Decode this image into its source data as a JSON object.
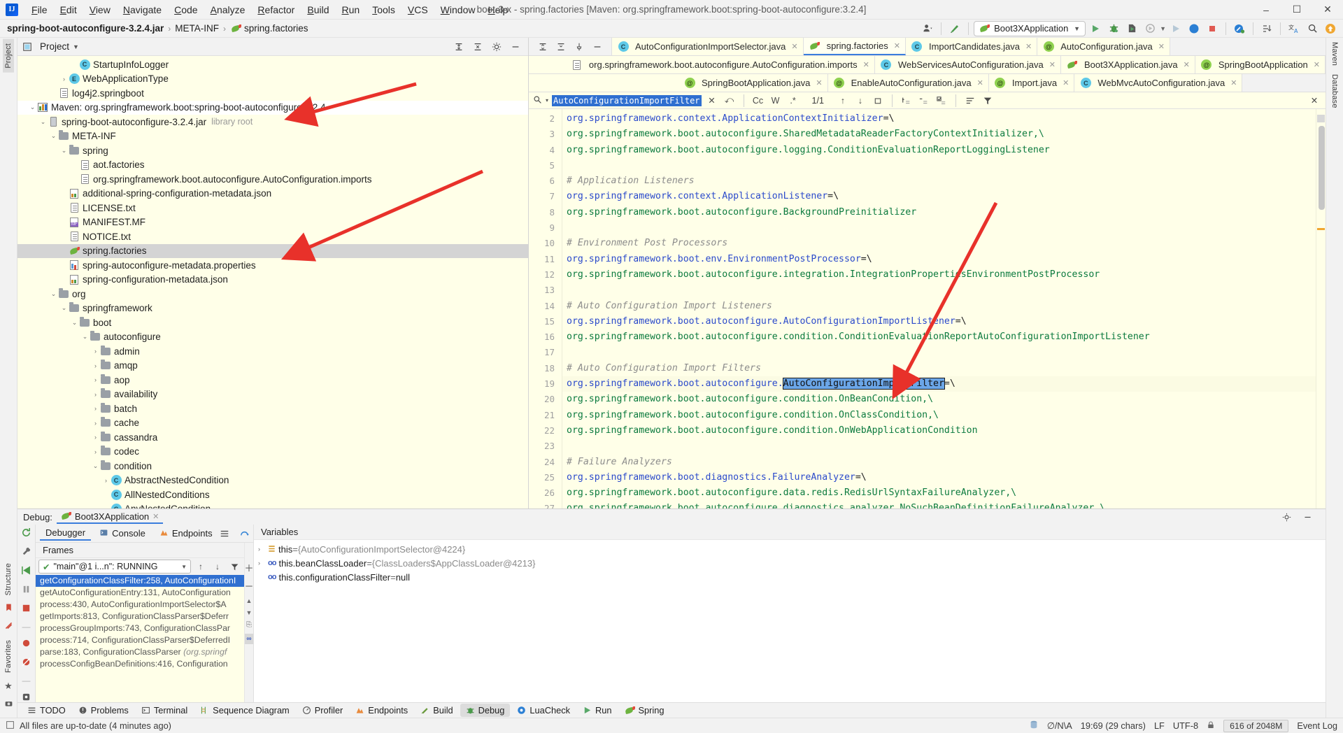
{
  "window": {
    "title": "boot-3-x - spring.factories [Maven: org.springframework.boot:spring-boot-autoconfigure:3.2.4]",
    "minimize": "–",
    "maximize": "☐",
    "close": "✕"
  },
  "menu": [
    "File",
    "Edit",
    "View",
    "Navigate",
    "Code",
    "Analyze",
    "Refactor",
    "Build",
    "Run",
    "Tools",
    "VCS",
    "Window",
    "Help"
  ],
  "navbar": {
    "crumbs": [
      "spring-boot-autoconfigure-3.2.4.jar",
      "META-INF",
      "spring.factories"
    ],
    "separator": "›",
    "run_config": "Boot3XApplication",
    "icons": {
      "account": "account-icon",
      "updates": "update-icon",
      "run": "run-icon",
      "debug": "debug-icon",
      "run_with_coverage": "coverage-icon",
      "profiler": "profiler-icon",
      "stop": "stop-icon",
      "search": "search-icon",
      "translate": "translate-icon",
      "notifications": "notification-icon"
    }
  },
  "left_rail": {
    "tabs": [
      "Project",
      "Structure",
      "Favorites"
    ]
  },
  "right_rail": {
    "tabs": [
      "Maven",
      "Database"
    ]
  },
  "project": {
    "title": "Project",
    "tree": [
      {
        "indent": 5,
        "chev": "",
        "icon": "class",
        "label": "StartupInfoLogger"
      },
      {
        "indent": 4,
        "chev": "›",
        "icon": "enum",
        "label": "WebApplicationType"
      },
      {
        "indent": 3,
        "chev": "",
        "icon": "file",
        "label": "log4j2.springboot"
      },
      {
        "indent": 1,
        "chev": "⌄",
        "icon": "maven",
        "label": "Maven: org.springframework.boot:spring-boot-autoconfigure:3.2.4",
        "state": "focused"
      },
      {
        "indent": 2,
        "chev": "⌄",
        "icon": "jar",
        "label": "spring-boot-autoconfigure-3.2.4.jar",
        "dim": "library root"
      },
      {
        "indent": 3,
        "chev": "⌄",
        "icon": "folder",
        "label": "META-INF"
      },
      {
        "indent": 4,
        "chev": "⌄",
        "icon": "folder",
        "label": "spring"
      },
      {
        "indent": 5,
        "chev": "",
        "icon": "file",
        "label": "aot.factories"
      },
      {
        "indent": 5,
        "chev": "",
        "icon": "file",
        "label": "org.springframework.boot.autoconfigure.AutoConfiguration.imports"
      },
      {
        "indent": 4,
        "chev": "",
        "icon": "json",
        "label": "additional-spring-configuration-metadata.json"
      },
      {
        "indent": 4,
        "chev": "",
        "icon": "file",
        "label": "LICENSE.txt"
      },
      {
        "indent": 4,
        "chev": "",
        "icon": "mf",
        "label": "MANIFEST.MF"
      },
      {
        "indent": 4,
        "chev": "",
        "icon": "file",
        "label": "NOTICE.txt"
      },
      {
        "indent": 4,
        "chev": "",
        "icon": "spring",
        "label": "spring.factories",
        "state": "selected"
      },
      {
        "indent": 4,
        "chev": "",
        "icon": "props",
        "label": "spring-autoconfigure-metadata.properties"
      },
      {
        "indent": 4,
        "chev": "",
        "icon": "json",
        "label": "spring-configuration-metadata.json"
      },
      {
        "indent": 3,
        "chev": "⌄",
        "icon": "folder",
        "label": "org"
      },
      {
        "indent": 4,
        "chev": "⌄",
        "icon": "folder",
        "label": "springframework"
      },
      {
        "indent": 5,
        "chev": "⌄",
        "icon": "folder",
        "label": "boot"
      },
      {
        "indent": 6,
        "chev": "⌄",
        "icon": "folder",
        "label": "autoconfigure"
      },
      {
        "indent": 7,
        "chev": "›",
        "icon": "folder",
        "label": "admin"
      },
      {
        "indent": 7,
        "chev": "›",
        "icon": "folder",
        "label": "amqp"
      },
      {
        "indent": 7,
        "chev": "›",
        "icon": "folder",
        "label": "aop"
      },
      {
        "indent": 7,
        "chev": "›",
        "icon": "folder",
        "label": "availability"
      },
      {
        "indent": 7,
        "chev": "›",
        "icon": "folder",
        "label": "batch"
      },
      {
        "indent": 7,
        "chev": "›",
        "icon": "folder",
        "label": "cache"
      },
      {
        "indent": 7,
        "chev": "›",
        "icon": "folder",
        "label": "cassandra"
      },
      {
        "indent": 7,
        "chev": "›",
        "icon": "folder",
        "label": "codec"
      },
      {
        "indent": 7,
        "chev": "⌄",
        "icon": "folder",
        "label": "condition"
      },
      {
        "indent": 8,
        "chev": "›",
        "icon": "class",
        "label": "AbstractNestedCondition"
      },
      {
        "indent": 8,
        "chev": "",
        "icon": "class",
        "label": "AllNestedConditions"
      },
      {
        "indent": 8,
        "chev": "",
        "icon": "class",
        "label": "AnyNestedCondition"
      }
    ]
  },
  "editor": {
    "tab_rows": [
      [
        {
          "icon": "class",
          "label": "AutoConfigurationImportSelector.java",
          "active": false
        },
        {
          "icon": "spring",
          "label": "spring.factories",
          "active": true
        },
        {
          "icon": "class",
          "label": "ImportCandidates.java",
          "active": false
        },
        {
          "icon": "annotation",
          "label": "AutoConfiguration.java",
          "active": false
        }
      ],
      [
        {
          "icon": "file",
          "label": "org.springframework.boot.autoconfigure.AutoConfiguration.imports",
          "active": false
        },
        {
          "icon": "class",
          "label": "WebServicesAutoConfiguration.java",
          "active": false
        },
        {
          "icon": "springapp",
          "label": "Boot3XApplication.java",
          "active": false
        },
        {
          "icon": "annotation",
          "label": "SpringBootApplication",
          "active": false
        }
      ],
      [
        {
          "icon": "annotation",
          "label": "SpringBootApplication.java",
          "active": false
        },
        {
          "icon": "annotation",
          "label": "EnableAutoConfiguration.java",
          "active": false
        },
        {
          "icon": "annotation",
          "label": "Import.java",
          "active": false
        },
        {
          "icon": "class",
          "label": "WebMvcAutoConfiguration.java",
          "active": false
        }
      ]
    ],
    "find": {
      "query": "AutoConfigurationImportFilter",
      "match_count": "1/1",
      "options": [
        "Cc",
        "W",
        ".*"
      ],
      "icons": [
        "search-icon",
        "clear-icon",
        "history-icon",
        "prev-match-icon",
        "next-match-icon",
        "select-all-icon",
        "add-line-icon",
        "remove-line-icon",
        "toggle-line-icon",
        "filter-list-icon",
        "filter-icon",
        "close-icon"
      ]
    },
    "line_start": 2,
    "lines": [
      {
        "n": 2,
        "segs": [
          {
            "t": "org.springframework.context.ApplicationContextInitializer",
            "c": "blue"
          },
          {
            "t": "=\\",
            "c": "punct"
          }
        ]
      },
      {
        "n": 3,
        "segs": [
          {
            "t": "org.springframework.boot.autoconfigure.SharedMetadataReaderFactoryContextInitializer,\\",
            "c": "green"
          }
        ]
      },
      {
        "n": 4,
        "segs": [
          {
            "t": "org.springframework.boot.autoconfigure.logging.ConditionEvaluationReportLoggingListener",
            "c": "green"
          }
        ]
      },
      {
        "n": 5,
        "segs": []
      },
      {
        "n": 6,
        "segs": [
          {
            "t": "# Application Listeners",
            "c": "comment"
          }
        ]
      },
      {
        "n": 7,
        "segs": [
          {
            "t": "org.springframework.context.ApplicationListener",
            "c": "blue"
          },
          {
            "t": "=\\",
            "c": "punct"
          }
        ]
      },
      {
        "n": 8,
        "segs": [
          {
            "t": "org.springframework.boot.autoconfigure.BackgroundPreinitializer",
            "c": "green"
          }
        ]
      },
      {
        "n": 9,
        "segs": []
      },
      {
        "n": 10,
        "segs": [
          {
            "t": "# Environment Post Processors",
            "c": "comment"
          }
        ]
      },
      {
        "n": 11,
        "segs": [
          {
            "t": "org.springframework.boot.env.EnvironmentPostProcessor",
            "c": "blue"
          },
          {
            "t": "=\\",
            "c": "punct"
          }
        ]
      },
      {
        "n": 12,
        "segs": [
          {
            "t": "org.springframework.boot.autoconfigure.integration.IntegrationPropertiesEnvironmentPostProcessor",
            "c": "green"
          }
        ]
      },
      {
        "n": 13,
        "segs": []
      },
      {
        "n": 14,
        "segs": [
          {
            "t": "# Auto Configuration Import Listeners",
            "c": "comment"
          }
        ]
      },
      {
        "n": 15,
        "segs": [
          {
            "t": "org.springframework.boot.autoconfigure.AutoConfigurationImportListener",
            "c": "blue"
          },
          {
            "t": "=\\",
            "c": "punct"
          }
        ]
      },
      {
        "n": 16,
        "segs": [
          {
            "t": "org.springframework.boot.autoconfigure.condition.ConditionEvaluationReportAutoConfigurationImportListener",
            "c": "green"
          }
        ]
      },
      {
        "n": 17,
        "segs": []
      },
      {
        "n": 18,
        "segs": [
          {
            "t": "# Auto Configuration Import Filters",
            "c": "comment"
          }
        ]
      },
      {
        "n": 19,
        "highlight": true,
        "segs": [
          {
            "t": "org.springframework.boot.autoconfigure.",
            "c": "blue"
          },
          {
            "t": "AutoConfigurationImportFilter",
            "c": "selword"
          },
          {
            "t": "=\\",
            "c": "punct"
          }
        ]
      },
      {
        "n": 20,
        "segs": [
          {
            "t": "org.springframework.boot.autoconfigure.condition.OnBeanCondition,\\",
            "c": "green"
          }
        ]
      },
      {
        "n": 21,
        "segs": [
          {
            "t": "org.springframework.boot.autoconfigure.condition.OnClassCondition,\\",
            "c": "green"
          }
        ]
      },
      {
        "n": 22,
        "segs": [
          {
            "t": "org.springframework.boot.autoconfigure.condition.OnWebApplicationCondition",
            "c": "green"
          }
        ]
      },
      {
        "n": 23,
        "segs": []
      },
      {
        "n": 24,
        "segs": [
          {
            "t": "# Failure Analyzers",
            "c": "comment"
          }
        ]
      },
      {
        "n": 25,
        "segs": [
          {
            "t": "org.springframework.boot.diagnostics.FailureAnalyzer",
            "c": "blue"
          },
          {
            "t": "=\\",
            "c": "punct"
          }
        ]
      },
      {
        "n": 26,
        "segs": [
          {
            "t": "org.springframework.boot.autoconfigure.data.redis.RedisUrlSyntaxFailureAnalyzer,\\",
            "c": "green"
          }
        ]
      },
      {
        "n": 27,
        "segs": [
          {
            "t": "org.springframework.boot.autoconfigure.diagnostics.analyzer.NoSuchBeanDefinitionFailureAnalyzer,\\",
            "c": "green"
          }
        ]
      }
    ]
  },
  "debug": {
    "label": "Debug:",
    "session": "Boot3XApplication",
    "tabs": [
      {
        "label": "Debugger",
        "icon": "debugger-icon",
        "active": true
      },
      {
        "label": "Console",
        "icon": "console-icon",
        "active": false
      },
      {
        "label": "Endpoints",
        "icon": "endpoints-icon",
        "active": false
      }
    ],
    "toolbar_icons": [
      "rerun-icon",
      "settings-icon",
      "resume-icon",
      "pause-icon",
      "stop-icon",
      "mute-breakpoints-icon",
      "view-breakpoints-icon",
      "layout-icon",
      "step-over-icon",
      "step-into-icon",
      "force-step-into-icon",
      "step-out-icon",
      "drop-frame-icon",
      "run-to-cursor-icon",
      "evaluate-icon",
      "settings2-icon"
    ],
    "frames_header": "Frames",
    "variables_header": "Variables",
    "thread": "\"main\"@1 i...n\": RUNNING",
    "frames": [
      {
        "text": "getConfigurationClassFilter:258, AutoConfigurationI",
        "selected": true
      },
      {
        "text": "getAutoConfigurationEntry:131, AutoConfiguration",
        "selected": false
      },
      {
        "text": "process:430, AutoConfigurationImportSelector$A",
        "selected": false
      },
      {
        "text": "getImports:813, ConfigurationClassParser$Deferr",
        "selected": false
      },
      {
        "text": "processGroupImports:743, ConfigurationClassPar",
        "selected": false
      },
      {
        "text": "process:714, ConfigurationClassParser$DeferredI",
        "selected": false
      },
      {
        "text": "parse:183, ConfigurationClassParser ",
        "italic": "(org.springf",
        "selected": false
      },
      {
        "text": "processConfigBeanDefinitions:416, Configuration",
        "selected": false
      }
    ],
    "variables": [
      {
        "chev": "›",
        "icon": "object-icon",
        "name": "this",
        "eq": " = ",
        "value": "{AutoConfigurationImportSelector@4224}"
      },
      {
        "chev": "›",
        "icon": "field-icon",
        "name": "this.beanClassLoader",
        "eq": " = ",
        "value": "{ClassLoaders$AppClassLoader@4213}"
      },
      {
        "chev": "",
        "icon": "field-icon",
        "name": "this.configurationClassFilter",
        "eq": " = ",
        "value": "null",
        "null": true
      }
    ]
  },
  "tool_windows": [
    {
      "label": "TODO",
      "icon": "todo-icon",
      "active": false
    },
    {
      "label": "Problems",
      "icon": "problems-icon",
      "active": false
    },
    {
      "label": "Terminal",
      "icon": "terminal-icon",
      "active": false
    },
    {
      "label": "Sequence Diagram",
      "icon": "sequence-diagram-icon",
      "active": false
    },
    {
      "label": "Profiler",
      "icon": "profiler-icon",
      "active": false
    },
    {
      "label": "Endpoints",
      "icon": "endpoints-icon",
      "active": false
    },
    {
      "label": "Build",
      "icon": "build-icon",
      "active": false
    },
    {
      "label": "Debug",
      "icon": "debug-icon",
      "active": true
    },
    {
      "label": "LuaCheck",
      "icon": "luacheck-icon",
      "active": false
    },
    {
      "label": "Run",
      "icon": "run-icon",
      "active": false
    },
    {
      "label": "Spring",
      "icon": "spring-icon",
      "active": false
    }
  ],
  "status": {
    "message": "All files are up-to-date (4 minutes ago)",
    "inspection": "∅/N\\A",
    "caret": "19:69 (29 chars)",
    "line_sep": "LF",
    "encoding": "UTF-8",
    "memory": "616 of 2048M",
    "event_log": "Event Log"
  },
  "colors": {
    "accent": "#3b7ddd",
    "selection": "#2f6fd0",
    "editor_bg": "#ffffe8",
    "string_green": "#0b7a3e",
    "key_blue": "#2b4acb",
    "arrow_red": "#e8312a",
    "spring_green": "#6db33f"
  }
}
